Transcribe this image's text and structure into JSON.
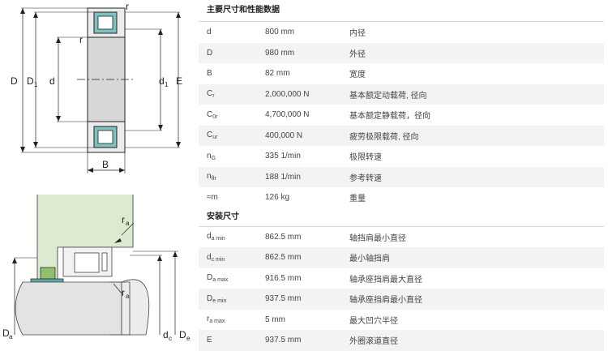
{
  "diagram_top": {
    "labels": {
      "r": "r",
      "D": "D",
      "D1": "D",
      "D1_sub": "1",
      "d": "d",
      "d1": "d",
      "d1_sub": "1",
      "E": "E",
      "B": "B"
    }
  },
  "diagram_bottom": {
    "labels": {
      "ra": "r",
      "ra_sub": "a",
      "Da": "D",
      "Da_sub": "a",
      "dc": "d",
      "dc_sub": "c",
      "De": "D",
      "De_sub": "e"
    }
  },
  "main_section": {
    "title": "主要尺寸和性能数据",
    "rows": [
      {
        "sym": "d",
        "sub": "",
        "value": "800 mm",
        "desc": "内径"
      },
      {
        "sym": "D",
        "sub": "",
        "value": "980 mm",
        "desc": "外径"
      },
      {
        "sym": "B",
        "sub": "",
        "value": "82 mm",
        "desc": "宽度"
      },
      {
        "sym": "C",
        "sub": "r",
        "value": "2,000,000 N",
        "desc": "基本额定动载荷, 径向"
      },
      {
        "sym": "C",
        "sub": "0r",
        "value": "4,700,000 N",
        "desc": "基本额定静载荷，径向"
      },
      {
        "sym": "C",
        "sub": "ur",
        "value": "400,000 N",
        "desc": "疲劳极限载荷, 径向"
      },
      {
        "sym": "n",
        "sub": "G",
        "value": "335 1/min",
        "desc": "极限转速"
      },
      {
        "sym": "n",
        "sub": "θr",
        "value": "188 1/min",
        "desc": "参考转速"
      },
      {
        "sym": "≈m",
        "sub": "",
        "value": "126 kg",
        "desc": "重量"
      }
    ]
  },
  "mount_section": {
    "title": "安装尺寸",
    "rows": [
      {
        "sym": "d",
        "sub": "a min",
        "value": "862.5 mm",
        "desc": "轴挡肩最小直径"
      },
      {
        "sym": "d",
        "sub": "c min",
        "value": "862.5 mm",
        "desc": "最小轴挡肩"
      },
      {
        "sym": "D",
        "sub": "a max",
        "value": "916.5 mm",
        "desc": "轴承座挡肩最大直径"
      },
      {
        "sym": "D",
        "sub": "e min",
        "value": "937.5 mm",
        "desc": "轴承座挡肩最小直径"
      },
      {
        "sym": "r",
        "sub": "a max",
        "value": "5 mm",
        "desc": "最大凹穴半径"
      },
      {
        "sym": "E",
        "sub": "",
        "value": "937.5 mm",
        "desc": "外圈滚道直径"
      }
    ]
  }
}
